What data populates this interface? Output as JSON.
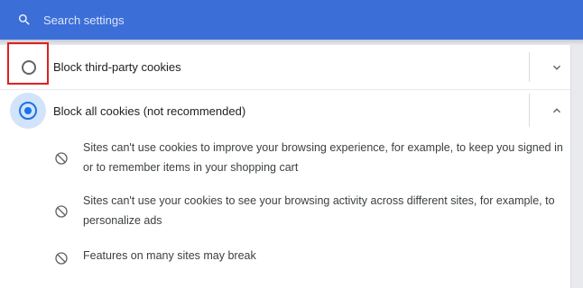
{
  "search": {
    "placeholder": "Search settings"
  },
  "options": [
    {
      "label": "Block third-party cookies",
      "selected": false,
      "expanded": false
    },
    {
      "label": "Block all cookies (not recommended)",
      "selected": true,
      "expanded": true
    }
  ],
  "details": [
    "Sites can't use cookies to improve your browsing experience, for example, to keep you signed in or to remember items in your shopping cart",
    "Sites can't use your cookies to see your browsing activity across different sites, for example, to personalize ads",
    "Features on many sites may break"
  ],
  "colors": {
    "header": "#3c6ed8",
    "accent": "#1a73e8",
    "highlight": "#e02020"
  },
  "icons": {
    "search": "search-icon",
    "expand": "chevron-down-icon",
    "collapse": "chevron-up-icon",
    "blocked": "block-icon"
  }
}
